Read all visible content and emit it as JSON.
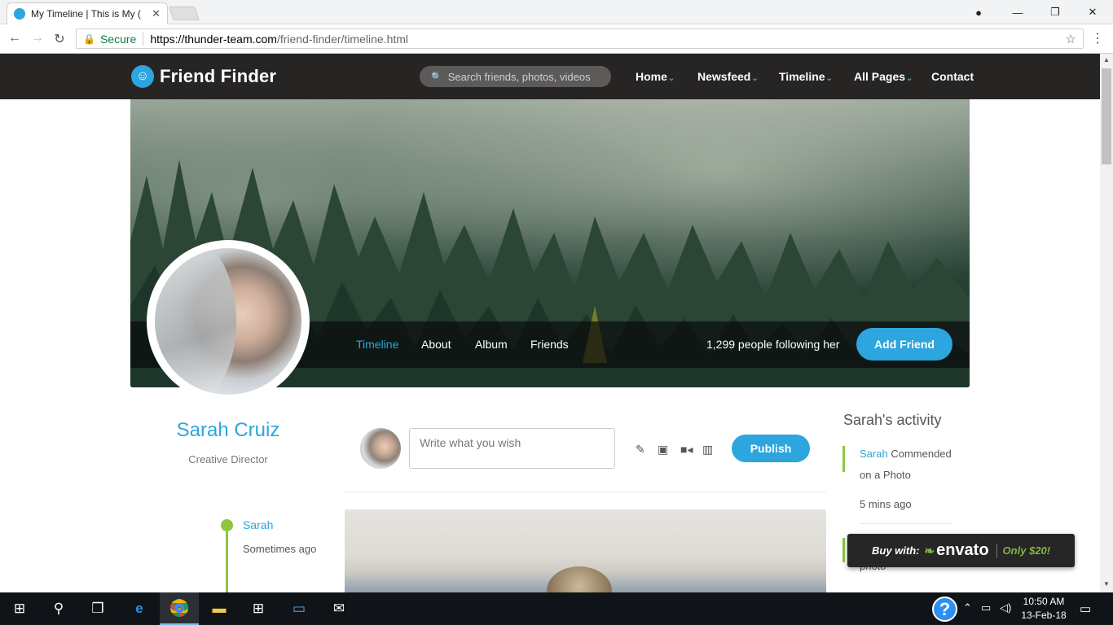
{
  "browser": {
    "tab_title": "My Timeline | This is My (",
    "secure_label": "Secure",
    "url_host": "https://thunder-team.com",
    "url_path": "/friend-finder/timeline.html"
  },
  "site": {
    "brand": "Friend Finder",
    "search_placeholder": "Search friends, photos, videos",
    "nav": [
      {
        "label": "Home",
        "caret": true
      },
      {
        "label": "Newsfeed",
        "caret": true
      },
      {
        "label": "Timeline",
        "caret": true
      },
      {
        "label": "All Pages",
        "caret": true
      },
      {
        "label": "Contact",
        "caret": false
      }
    ]
  },
  "profile": {
    "tabs": [
      "Timeline",
      "About",
      "Album",
      "Friends"
    ],
    "active_tab": "Timeline",
    "followers": "1,299 people following her",
    "add_friend": "Add Friend",
    "name": "Sarah Cruiz",
    "role": "Creative Director",
    "timeline_item": {
      "name": "Sarah",
      "time": "Sometimes ago"
    }
  },
  "composer": {
    "placeholder": "Write what you wish",
    "tools": [
      "edit-icon",
      "image-icon",
      "video-icon",
      "map-icon"
    ],
    "publish": "Publish"
  },
  "activity": {
    "title": "Sarah's activity",
    "items": [
      {
        "name": "Sarah",
        "text": "Commended",
        "text2": "on a Photo",
        "time": "5 mins ago"
      },
      {
        "text2": "photo"
      }
    ]
  },
  "envato": {
    "buy": "Buy with:",
    "brand": "envato",
    "price": "Only $20!"
  },
  "taskbar": {
    "time": "10:50 AM",
    "date": "13-Feb-18"
  },
  "colors": {
    "accent": "#2da5de",
    "green": "#8dc63f",
    "header": "#272424"
  }
}
